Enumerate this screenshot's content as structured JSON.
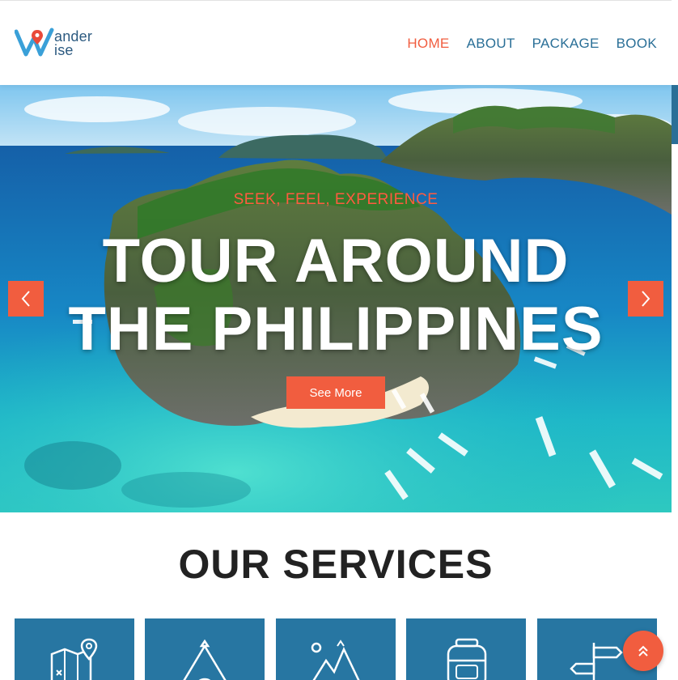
{
  "brand": {
    "logo_line1": "ander",
    "logo_line2": "ise",
    "logo_icon": "w-pin-logo-icon"
  },
  "nav": {
    "items": [
      {
        "label": "HOME",
        "active": true
      },
      {
        "label": "ABOUT",
        "active": false
      },
      {
        "label": "PACKAGE",
        "active": false
      },
      {
        "label": "BOOK",
        "active": false
      }
    ]
  },
  "hero": {
    "tagline": "SEEK, FEEL, EXPERIENCE",
    "headline_line1": "TOUR AROUND",
    "headline_line2": "THE PHILIPPINES",
    "cta_label": "See More",
    "prev_icon": "chevron-left-icon",
    "next_icon": "chevron-right-icon"
  },
  "services": {
    "title": "OUR SERVICES",
    "items": [
      {
        "icon": "map-icon"
      },
      {
        "icon": "tent-icon"
      },
      {
        "icon": "mountain-icon"
      },
      {
        "icon": "backpack-icon"
      },
      {
        "icon": "signpost-icon"
      }
    ]
  },
  "back_to_top": {
    "icon": "double-chevron-up-icon"
  },
  "colors": {
    "accent": "#f15d3f",
    "nav_text": "#2a6f97",
    "service_tile": "#2776a2",
    "heading": "#222222"
  }
}
